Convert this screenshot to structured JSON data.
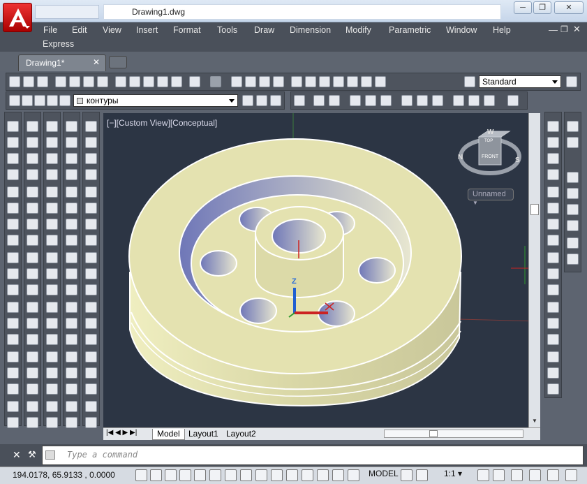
{
  "window": {
    "title": "Drawing1.dwg",
    "controls": [
      "minimize",
      "restore",
      "close"
    ]
  },
  "menu": {
    "items": [
      "File",
      "Edit",
      "View",
      "Insert",
      "Format",
      "Tools",
      "Draw",
      "Dimension",
      "Modify",
      "Parametric",
      "Window",
      "Help",
      "Express"
    ]
  },
  "document_tab": {
    "label": "Drawing1*"
  },
  "toolbar_standard": {
    "style_combo": "Standard"
  },
  "toolbar_layers": {
    "layer_combo": "контуры"
  },
  "viewport": {
    "label": "[−][Custom View][Conceptual]"
  },
  "viewcube": {
    "top": "TOP",
    "front": "FRONT",
    "compass": [
      "W",
      "N",
      "S"
    ],
    "ucs_menu": "Unnamed"
  },
  "layout_tabs": [
    "Model",
    "Layout1",
    "Layout2"
  ],
  "command": {
    "placeholder": "Type a command"
  },
  "status": {
    "coordinates": "194.0178,  65.9133 , 0.0000",
    "model": "MODEL",
    "scale": "1:1"
  },
  "colors": {
    "accent_red": "#cc1f1f",
    "viewport_bg": "#2c3544",
    "part_fill": "#e4e2b0",
    "hole_shade": "#6f77b8"
  }
}
